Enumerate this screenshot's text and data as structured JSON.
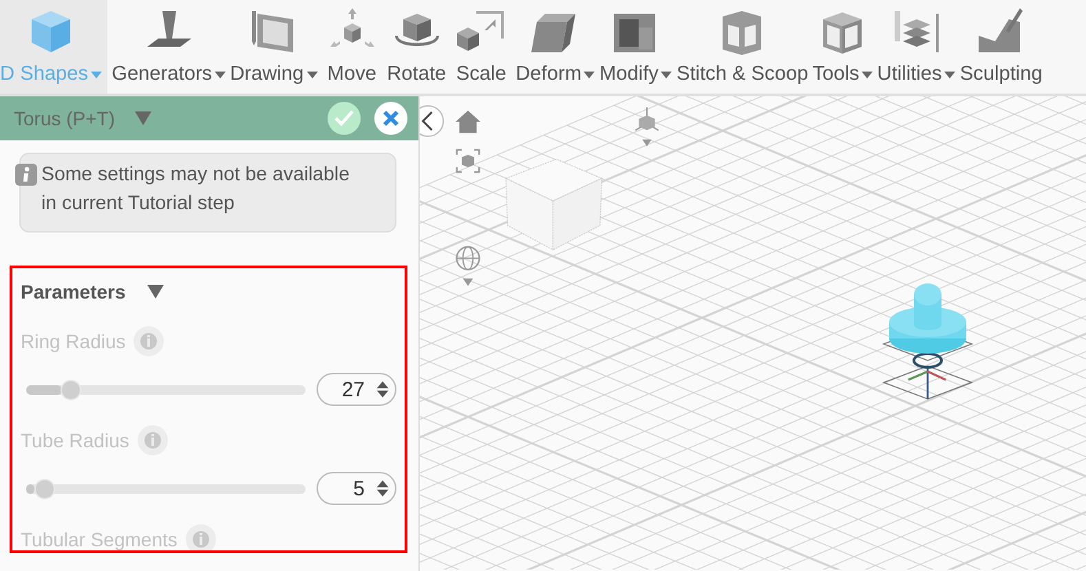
{
  "toolbar": [
    {
      "label": "D Shapes",
      "dropdown": true,
      "selected": true
    },
    {
      "label": "Generators",
      "dropdown": true,
      "selected": false
    },
    {
      "label": "Drawing",
      "dropdown": true,
      "selected": false
    },
    {
      "label": "Move",
      "dropdown": false,
      "selected": false
    },
    {
      "label": "Rotate",
      "dropdown": false,
      "selected": false
    },
    {
      "label": "Scale",
      "dropdown": false,
      "selected": false
    },
    {
      "label": "Deform",
      "dropdown": true,
      "selected": false
    },
    {
      "label": "Modify",
      "dropdown": true,
      "selected": false
    },
    {
      "label": "Stitch & Scoop",
      "dropdown": false,
      "selected": false
    },
    {
      "label": "Tools",
      "dropdown": true,
      "selected": false
    },
    {
      "label": "Utilities",
      "dropdown": true,
      "selected": false
    },
    {
      "label": "Sculpting",
      "dropdown": false,
      "selected": false
    }
  ],
  "panel": {
    "title": "Torus (P+T)",
    "info": "Some settings may not be available in current Tutorial step",
    "section": {
      "title": "Parameters",
      "expanded": true,
      "highlighted": true
    },
    "params": [
      {
        "kind": "slider",
        "label": "Ring Radius",
        "disabled": true,
        "level": 0.13,
        "value": "27"
      },
      {
        "kind": "slider",
        "label": "Tube Radius",
        "disabled": true,
        "level": 0.03,
        "value": "5"
      },
      {
        "kind": "heading",
        "label": "Tubular Segments",
        "disabled": true
      }
    ]
  }
}
